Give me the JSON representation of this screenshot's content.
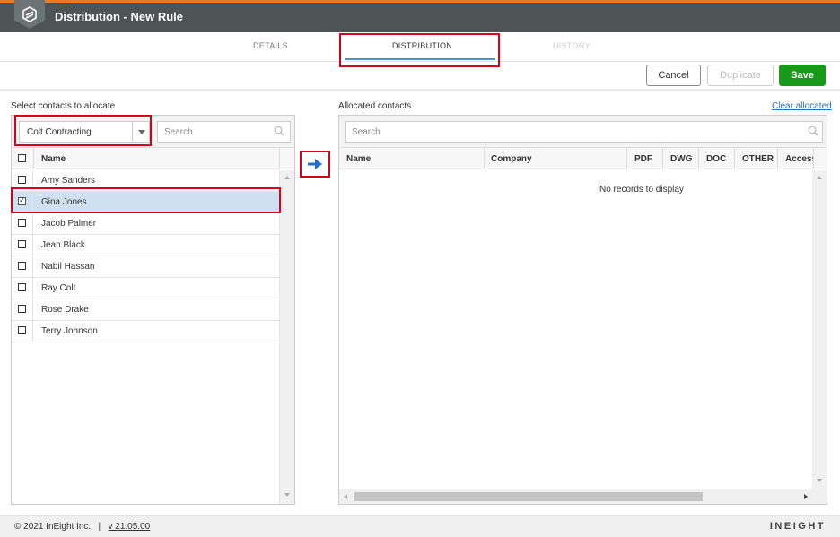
{
  "header": {
    "title": "Distribution - New Rule",
    "logo_icon": "ineight-logo-icon"
  },
  "tabs": [
    {
      "label": "DETAILS",
      "state": "normal"
    },
    {
      "label": "DISTRIBUTION",
      "state": "active"
    },
    {
      "label": "HISTORY",
      "state": "disabled"
    }
  ],
  "actions": {
    "cancel": "Cancel",
    "duplicate": "Duplicate",
    "save": "Save"
  },
  "left": {
    "label": "Select contacts to allocate",
    "company_select": "Colt Contracting",
    "search_placeholder": "Search",
    "column_name": "Name",
    "contacts": [
      {
        "name": "Amy Sanders",
        "checked": false
      },
      {
        "name": "Gina Jones",
        "checked": true
      },
      {
        "name": "Jacob Palmer",
        "checked": false
      },
      {
        "name": "Jean Black",
        "checked": false
      },
      {
        "name": "Nabil Hassan",
        "checked": false
      },
      {
        "name": "Ray Colt",
        "checked": false
      },
      {
        "name": "Rose Drake",
        "checked": false
      },
      {
        "name": "Terry Johnson",
        "checked": false
      }
    ]
  },
  "right": {
    "label": "Allocated contacts",
    "clear_link": "Clear allocated",
    "search_placeholder": "Search",
    "columns": [
      "Name",
      "Company",
      "PDF",
      "DWG",
      "DOC",
      "OTHER",
      "Access"
    ],
    "empty_message": "No records to display"
  },
  "footer": {
    "copyright": "© 2021 InEight Inc.",
    "separator": "|",
    "version": "v 21.05.00",
    "brand": "INEIGHT"
  },
  "colors": {
    "accent": "#e57a27",
    "save": "#1a9a1a",
    "highlight": "#d9001b",
    "link": "#2a6ebb",
    "arrow": "#1f6fd1"
  }
}
